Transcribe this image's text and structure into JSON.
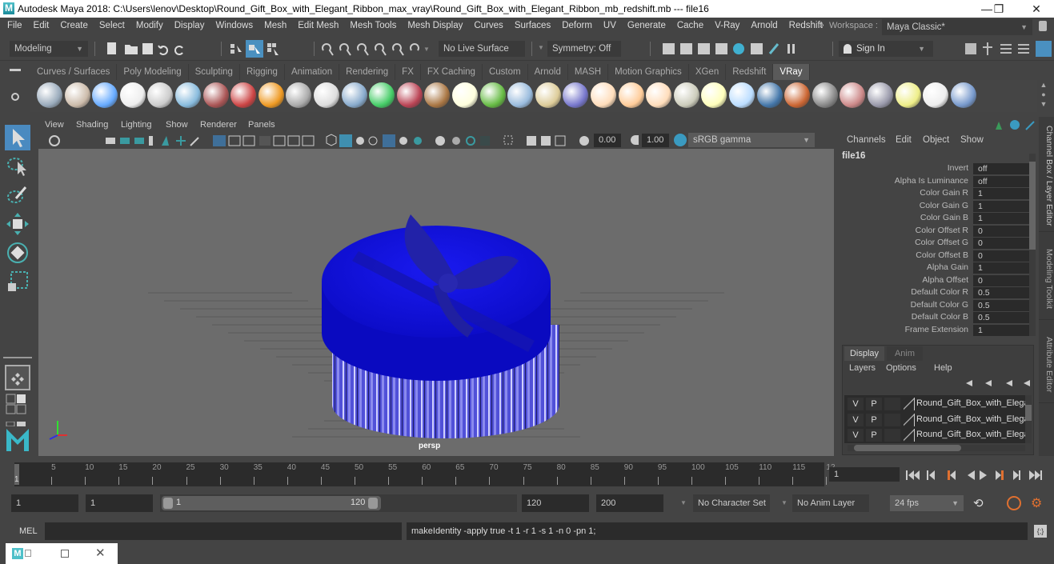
{
  "window": {
    "title": "Autodesk Maya 2018: C:\\Users\\lenov\\Desktop\\Round_Gift_Box_with_Elegant_Ribbon_max_vray\\Round_Gift_Box_with_Elegant_Ribbon_mb_redshift.mb  ---  file16",
    "minimize": "—",
    "restore": "❐",
    "close": "✕"
  },
  "menubar": {
    "items": [
      "File",
      "Edit",
      "Create",
      "Select",
      "Modify",
      "Display",
      "Windows",
      "Mesh",
      "Edit Mesh",
      "Mesh Tools",
      "Mesh Display",
      "Curves",
      "Surfaces",
      "Deform",
      "UV",
      "Generate",
      "Cache",
      "V-Ray",
      "Arnold",
      "Redshift"
    ],
    "workspace_label": "Workspace :",
    "workspace_value": "Maya Classic*"
  },
  "statusline": {
    "mode": "Modeling",
    "live_surface": "No Live Surface",
    "symmetry": "Symmetry: Off",
    "sign_in": "Sign In"
  },
  "shelf": {
    "tabs": [
      "Curves / Surfaces",
      "Poly Modeling",
      "Sculpting",
      "Rigging",
      "Animation",
      "Rendering",
      "FX",
      "FX Caching",
      "Custom",
      "Arnold",
      "MASH",
      "Motion Graphics",
      "XGen",
      "Redshift",
      "VRay"
    ],
    "active_tab": "VRay",
    "icons": [
      "vray-export-icon",
      "vray-import-icon",
      "vray-settings-icon",
      "vray-logo-icon",
      "vray-log-icon",
      "vray-material-icon",
      "vray-camera-icon",
      "vray-blend-icon",
      "vray-fire-icon",
      "vray-plane-icon",
      "vray-proxy-icon",
      "vray-shape-icon",
      "vray-light-icon",
      "vray-scatter-icon",
      "vray-texture-icon",
      "vray-sphere-light-icon",
      "vray-fur-icon",
      "vray-displacement-icon",
      "vray-curve-icon",
      "vray-globe-icon",
      "vray-dome-icon",
      "vray-spot-icon",
      "vray-point-icon",
      "vray-ies-icon",
      "vray-sun-icon",
      "vray-sky-icon",
      "vray-sphere-icon",
      "vray-half-sphere-icon",
      "vray-checker-icon",
      "vray-framebuffer-icon",
      "vray-lightlister-icon",
      "vray-light-lister-icon",
      "vray-cloud-icon",
      "help-icon"
    ]
  },
  "viewport": {
    "menu": [
      "View",
      "Shading",
      "Lighting",
      "Show",
      "Renderer",
      "Panels"
    ],
    "exposure": "0.00",
    "gamma": "1.00",
    "color_space": "sRGB gamma",
    "camera_label": "persp",
    "object_colors": {
      "lid": "#1010e0",
      "body": "#4a4ae0",
      "stripe": "#c8c8ff"
    }
  },
  "channel_box": {
    "menu": [
      "Channels",
      "Edit",
      "Object",
      "Show"
    ],
    "node": "file16",
    "attributes": [
      {
        "label": "Invert",
        "value": "off"
      },
      {
        "label": "Alpha Is Luminance",
        "value": "off"
      },
      {
        "label": "Color Gain R",
        "value": "1"
      },
      {
        "label": "Color Gain G",
        "value": "1"
      },
      {
        "label": "Color Gain B",
        "value": "1"
      },
      {
        "label": "Color Offset R",
        "value": "0"
      },
      {
        "label": "Color Offset G",
        "value": "0"
      },
      {
        "label": "Color Offset B",
        "value": "0"
      },
      {
        "label": "Alpha Gain",
        "value": "1"
      },
      {
        "label": "Alpha Offset",
        "value": "0"
      },
      {
        "label": "Default Color R",
        "value": "0.5"
      },
      {
        "label": "Default Color G",
        "value": "0.5"
      },
      {
        "label": "Default Color B",
        "value": "0.5"
      },
      {
        "label": "Frame Extension",
        "value": "1"
      }
    ]
  },
  "layer_editor": {
    "tabs": [
      "Display",
      "Anim"
    ],
    "active_tab": "Display",
    "menu": [
      "Layers",
      "Options",
      "Help"
    ],
    "layers": [
      {
        "v": "V",
        "p": "P",
        "name": "Round_Gift_Box_with_Elega"
      },
      {
        "v": "V",
        "p": "P",
        "name": "Round_Gift_Box_with_Elega"
      },
      {
        "v": "V",
        "p": "P",
        "name": "Round_Gift_Box_with_Elega"
      }
    ]
  },
  "side_tabs": [
    "Channel Box / Layer Editor",
    "Modeling Toolkit",
    "Attribute Editor"
  ],
  "timeline": {
    "ticks": [
      "5",
      "10",
      "15",
      "20",
      "25",
      "30",
      "35",
      "40",
      "45",
      "50",
      "55",
      "60",
      "65",
      "70",
      "75",
      "80",
      "85",
      "90",
      "95",
      "100",
      "105",
      "110",
      "115",
      "12"
    ],
    "current_frame_marker": "1",
    "current_frame": "1"
  },
  "range": {
    "start": "1",
    "playback_start": "1",
    "slider_start": "1",
    "slider_end": "120",
    "playback_end": "120",
    "end": "200",
    "character_set": "No Character Set",
    "anim_layer": "No Anim Layer",
    "fps": "24 fps"
  },
  "command": {
    "mel_label": "MEL",
    "input": "",
    "result": "makeIdentity -apply true -t 1 -r 1 -s 1 -n 0 -pn 1;"
  }
}
